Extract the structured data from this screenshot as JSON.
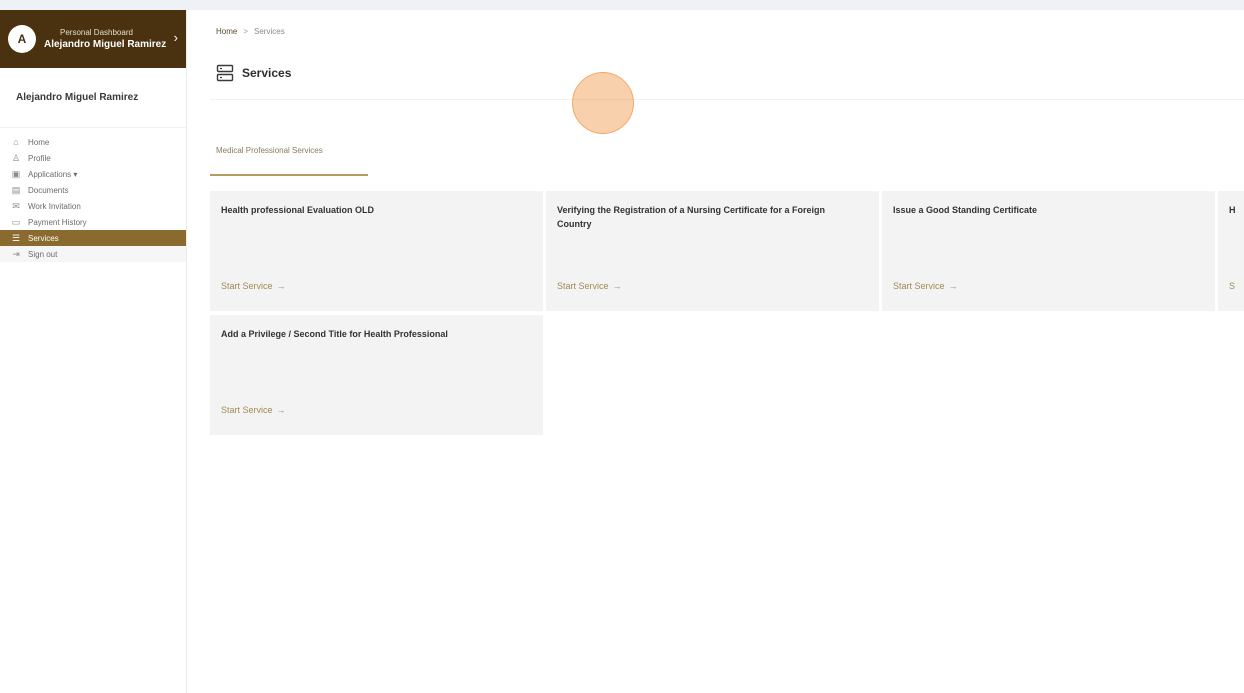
{
  "profile": {
    "subtitle": "Personal Dashboard",
    "name": "Alejandro Miguel Ramirez",
    "avatar_letter": "A",
    "chevron": "chevron-right-icon"
  },
  "sidebar": {
    "user_name": "Alejandro Miguel Ramirez",
    "items": [
      {
        "label": "Home",
        "icon": "home-icon",
        "glyph": "⌂"
      },
      {
        "label": "Profile",
        "icon": "user-icon",
        "glyph": "♙"
      },
      {
        "label": "Applications ▾",
        "icon": "applications-icon",
        "glyph": "▣"
      },
      {
        "label": "Documents",
        "icon": "documents-icon",
        "glyph": "▤"
      },
      {
        "label": "Work Invitation",
        "icon": "invitation-icon",
        "glyph": "✉"
      },
      {
        "label": "Payment History",
        "icon": "payment-icon",
        "glyph": "▭"
      },
      {
        "label": "Services",
        "icon": "services-icon",
        "glyph": "☰",
        "active": true
      },
      {
        "label": "Sign out",
        "icon": "sign-out-icon",
        "glyph": "⇥"
      }
    ]
  },
  "breadcrumb": {
    "home": "Home",
    "separator": ">",
    "current": "Services"
  },
  "page": {
    "title": "Services",
    "title_icon": "services-icon"
  },
  "tab": {
    "label": "Medical Professional Services"
  },
  "cards": [
    {
      "title": "Health professional Evaluation OLD",
      "link": "Start Service"
    },
    {
      "title": "Verifying the Registration of a Nursing Certificate for a Foreign Country",
      "link": "Start Service"
    },
    {
      "title": "Issue a Good Standing Certificate",
      "link": "Start Service"
    },
    {
      "title": "H",
      "link": "S"
    },
    {
      "title": "Add a Privilege / Second Title for Health Professional",
      "link": "Start Service"
    }
  ],
  "colors": {
    "brand_dark": "#4a3211",
    "active_nav": "#8a6a2e",
    "accent_link": "#a08a55",
    "card_bg": "#f3f3f3",
    "click_highlight": "#f09646"
  }
}
